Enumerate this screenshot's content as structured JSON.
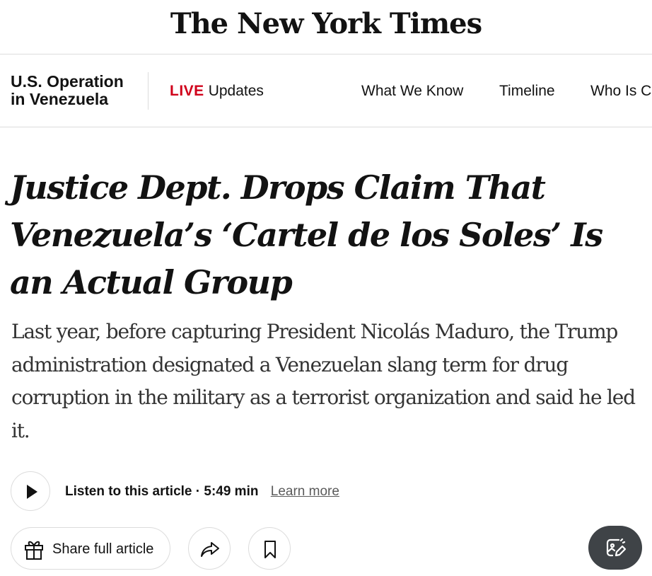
{
  "masthead": {
    "logo": "The New York Times"
  },
  "nav": {
    "section": "U.S. Operation in Venezuela",
    "live_badge": "LIVE",
    "live_text": "Updates",
    "links": [
      "What We Know",
      "Timeline",
      "Who Is C"
    ]
  },
  "article": {
    "headline": "Justice Dept. Drops Claim That Venezuela’s ‘Cartel de los Soles’ Is an Actual Group",
    "summary": "Last year, before capturing President Nicolás Maduro, the Trump administration designated a Venezuelan slang term for drug corruption in the military as a terrorist organization and said he led it."
  },
  "audio": {
    "label": "Listen to this article",
    "duration": "5:49 min",
    "learn_more": "Learn more"
  },
  "actions": {
    "share_label": "Share full article"
  },
  "icons": {
    "play": "play-icon",
    "gift": "gift-icon",
    "share": "share-arrow-icon",
    "bookmark": "bookmark-icon",
    "floating": "image-edit-icon"
  },
  "colors": {
    "live": "#d0021b",
    "floating_button": "#3f4347"
  }
}
